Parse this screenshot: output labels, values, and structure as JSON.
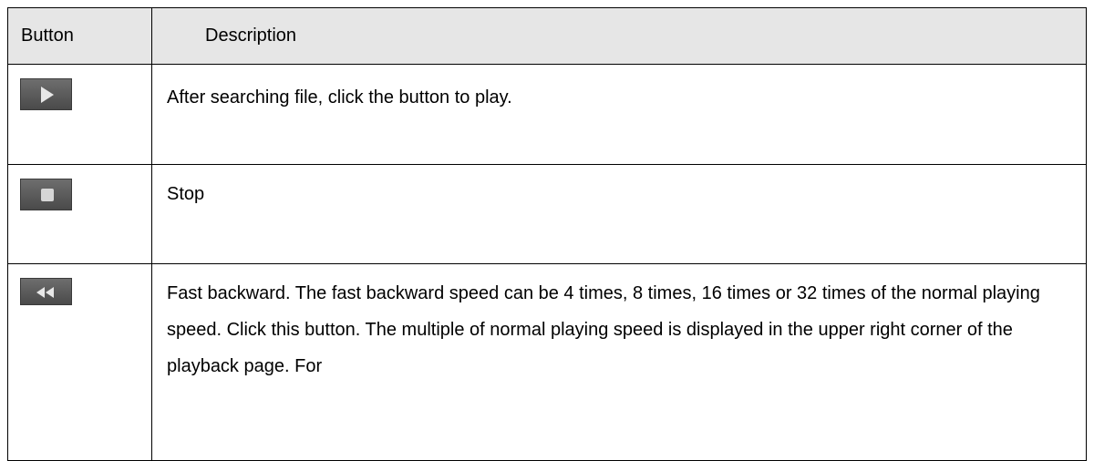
{
  "table": {
    "headers": {
      "button": "Button",
      "description": "Description"
    },
    "rows": [
      {
        "icon": "play-icon",
        "description": "After searching file, click the button to play."
      },
      {
        "icon": "stop-icon",
        "description": "Stop"
      },
      {
        "icon": "fast-backward-icon",
        "description": "Fast backward. The fast backward speed can be 4 times, 8 times, 16 times or 32 times of the normal playing speed. Click this button. The multiple of normal playing speed is displayed in the upper right corner of the playback page. For"
      }
    ]
  },
  "colors": {
    "header_bg": "#e6e6e6",
    "border": "#000000",
    "icon_bg": "#5a5a5a"
  }
}
